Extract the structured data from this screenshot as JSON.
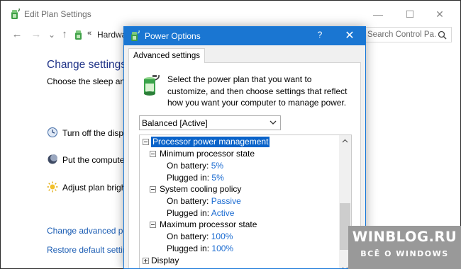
{
  "background_window": {
    "title": "Edit Plan Settings",
    "controls": {
      "minimize": "—",
      "maximize": "☐",
      "close": "✕"
    },
    "nav": {
      "back": "←",
      "forward": "→",
      "recent": "⌄",
      "up": "↑"
    },
    "breadcrumb_sep": "«",
    "breadcrumb": "Hardwa",
    "search_placeholder": "Search Control Pa...",
    "heading": "Change settings f",
    "subtext": "Choose the sleep and c",
    "rows": [
      {
        "label": "Turn off the displa",
        "icon": "display-clock-icon"
      },
      {
        "label": "Put the computer t",
        "icon": "moon-icon"
      },
      {
        "label": "Adjust plan brightn",
        "icon": "brightness-sun-icon"
      }
    ],
    "links": [
      {
        "label": "Change advanced pow"
      },
      {
        "label": "Restore default settings"
      }
    ]
  },
  "dialog": {
    "title": "Power Options",
    "help": "?",
    "close": "✕",
    "tab": "Advanced settings",
    "description": "Select the power plan that you want to customize, and then choose settings that reflect how you want your computer to manage power.",
    "plan_select": {
      "value": "Balanced [Active]"
    },
    "tree": {
      "root": {
        "label": "Processor power management",
        "expanded": true,
        "selected": true
      },
      "groups": [
        {
          "label": "Minimum processor state",
          "settings": [
            {
              "label": "On battery:",
              "value": "5%"
            },
            {
              "label": "Plugged in:",
              "value": "5%"
            }
          ]
        },
        {
          "label": "System cooling policy",
          "settings": [
            {
              "label": "On battery:",
              "value": "Passive"
            },
            {
              "label": "Plugged in:",
              "value": "Active"
            }
          ]
        },
        {
          "label": "Maximum processor state",
          "settings": [
            {
              "label": "On battery:",
              "value": "100%"
            },
            {
              "label": "Plugged in:",
              "value": "100%"
            }
          ]
        }
      ],
      "next_root": {
        "label": "Display",
        "expanded": false
      }
    }
  },
  "watermark": {
    "title": "WINBLOG.RU",
    "subtitle": "ВСЁ О WINDOWS"
  },
  "colors": {
    "dialog_titlebar": "#1a76d2",
    "selection": "#0a63c9",
    "value_link": "#1a6bd1",
    "heading": "#1e3287"
  }
}
